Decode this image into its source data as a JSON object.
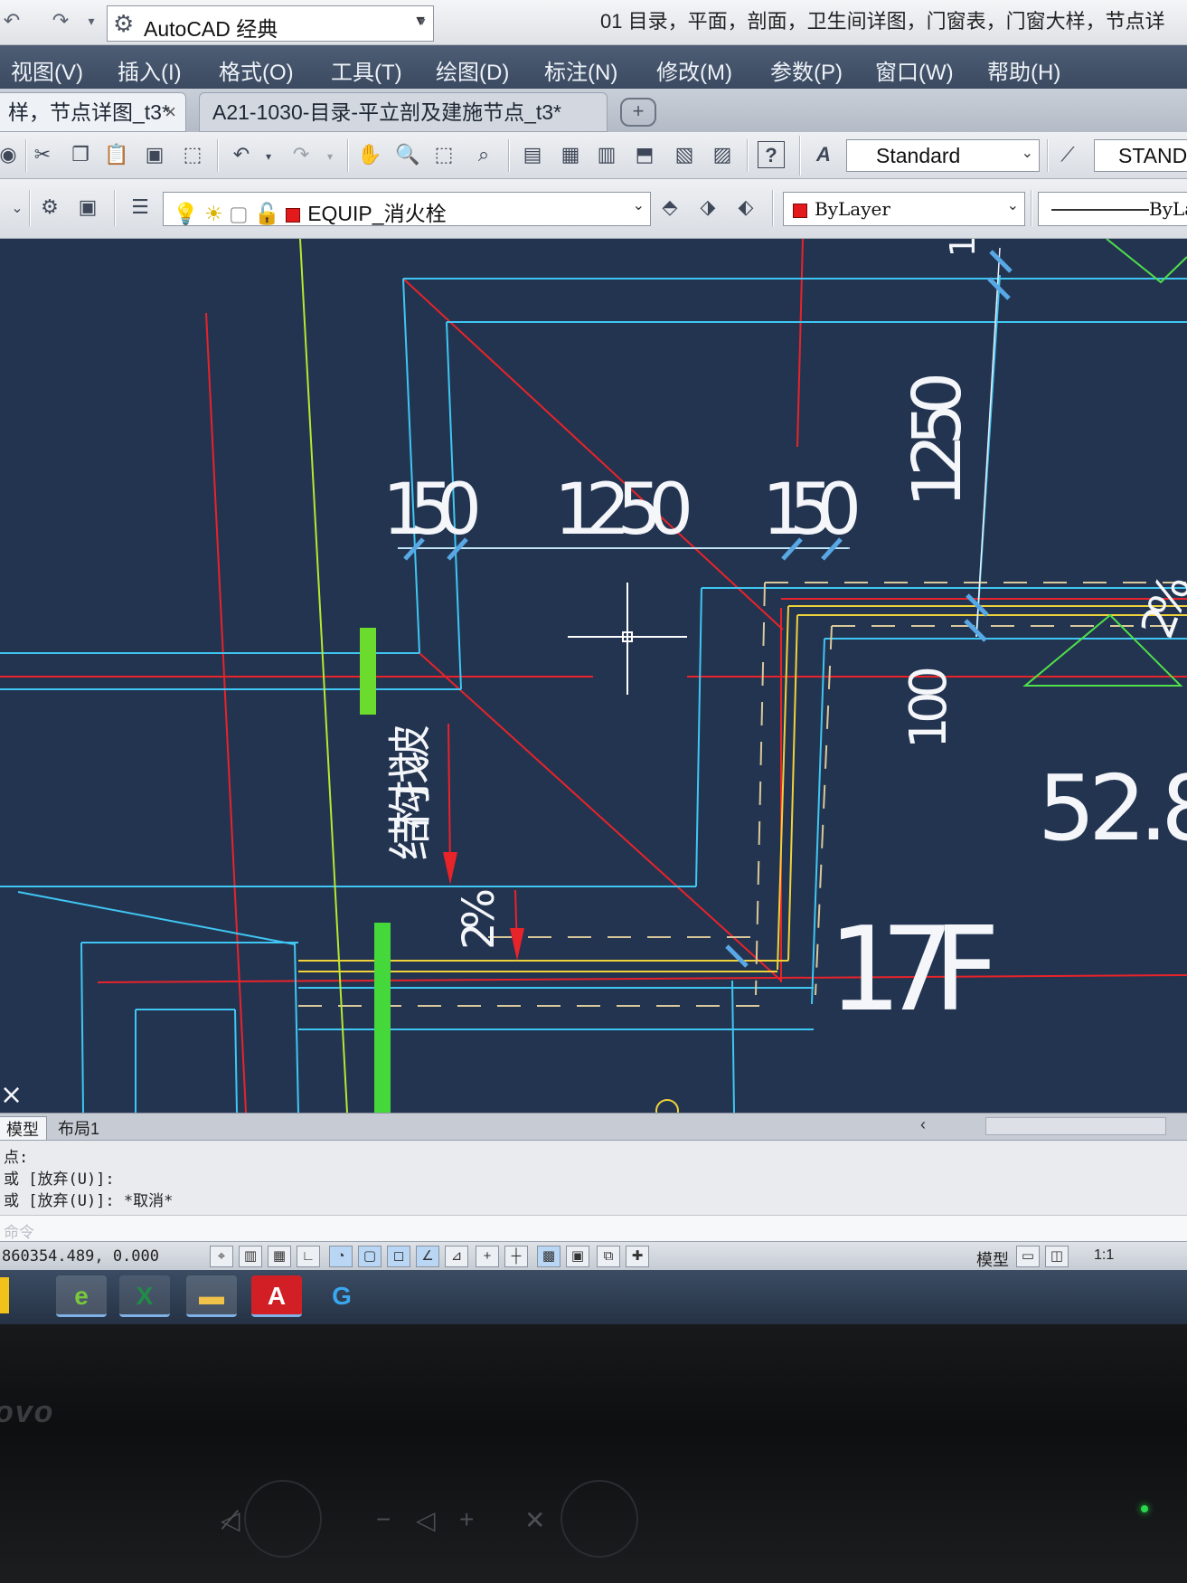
{
  "titlebar": {
    "workspace": "AutoCAD 经典",
    "title_text": "01 目录，平面，剖面，卫生间详图，门窗表，门窗大样，节点详"
  },
  "menubar": {
    "items": [
      "视图(V)",
      "插入(I)",
      "格式(O)",
      "工具(T)",
      "绘图(D)",
      "标注(N)",
      "修改(M)",
      "参数(P)",
      "窗口(W)",
      "帮助(H)"
    ]
  },
  "doctabs": {
    "tab1": "样，节点详图_t3*",
    "tab2": "A21-1030-目录-平立剖及建施节点_t3*",
    "close_glyph": "×",
    "new_tab_glyph": "+"
  },
  "toolbar1": {
    "text_style": "Standard",
    "dim_style": "STAND"
  },
  "toolbar2": {
    "layer": "EQUIP_消火栓",
    "color": "ByLayer",
    "linetype": "ByLa"
  },
  "drawing": {
    "dim_150_left": "150",
    "dim_1250_horizontal": "1250",
    "dim_150_right": "150",
    "dim_1250_vertical": "1250",
    "dim_100": "100",
    "slope_label": "结构找坡",
    "slope_percent": "2%",
    "slope_percent_right": "2%",
    "elevation": "52.8",
    "floor_label": "17F",
    "top_number": "1",
    "ucs_mark": "×"
  },
  "layout_tabs": {
    "model": "模型",
    "layout1": "布局1"
  },
  "command": {
    "lines": [
      "点:",
      "或 [放弃(U)]:",
      "或 [放弃(U)]: *取消*"
    ],
    "prompt": "命令"
  },
  "statusbar": {
    "coordinates": "860354.489, 0.000",
    "model": "模型",
    "scale": "1:1"
  },
  "bezel": {
    "brand": "ovo"
  },
  "colors": {
    "canvas_bg": "#233450",
    "cyan": "#3fc6f2",
    "red": "#e8232a",
    "yellow": "#f0d23a",
    "green": "#4fe04a",
    "dim_text": "#f4f6fa"
  }
}
